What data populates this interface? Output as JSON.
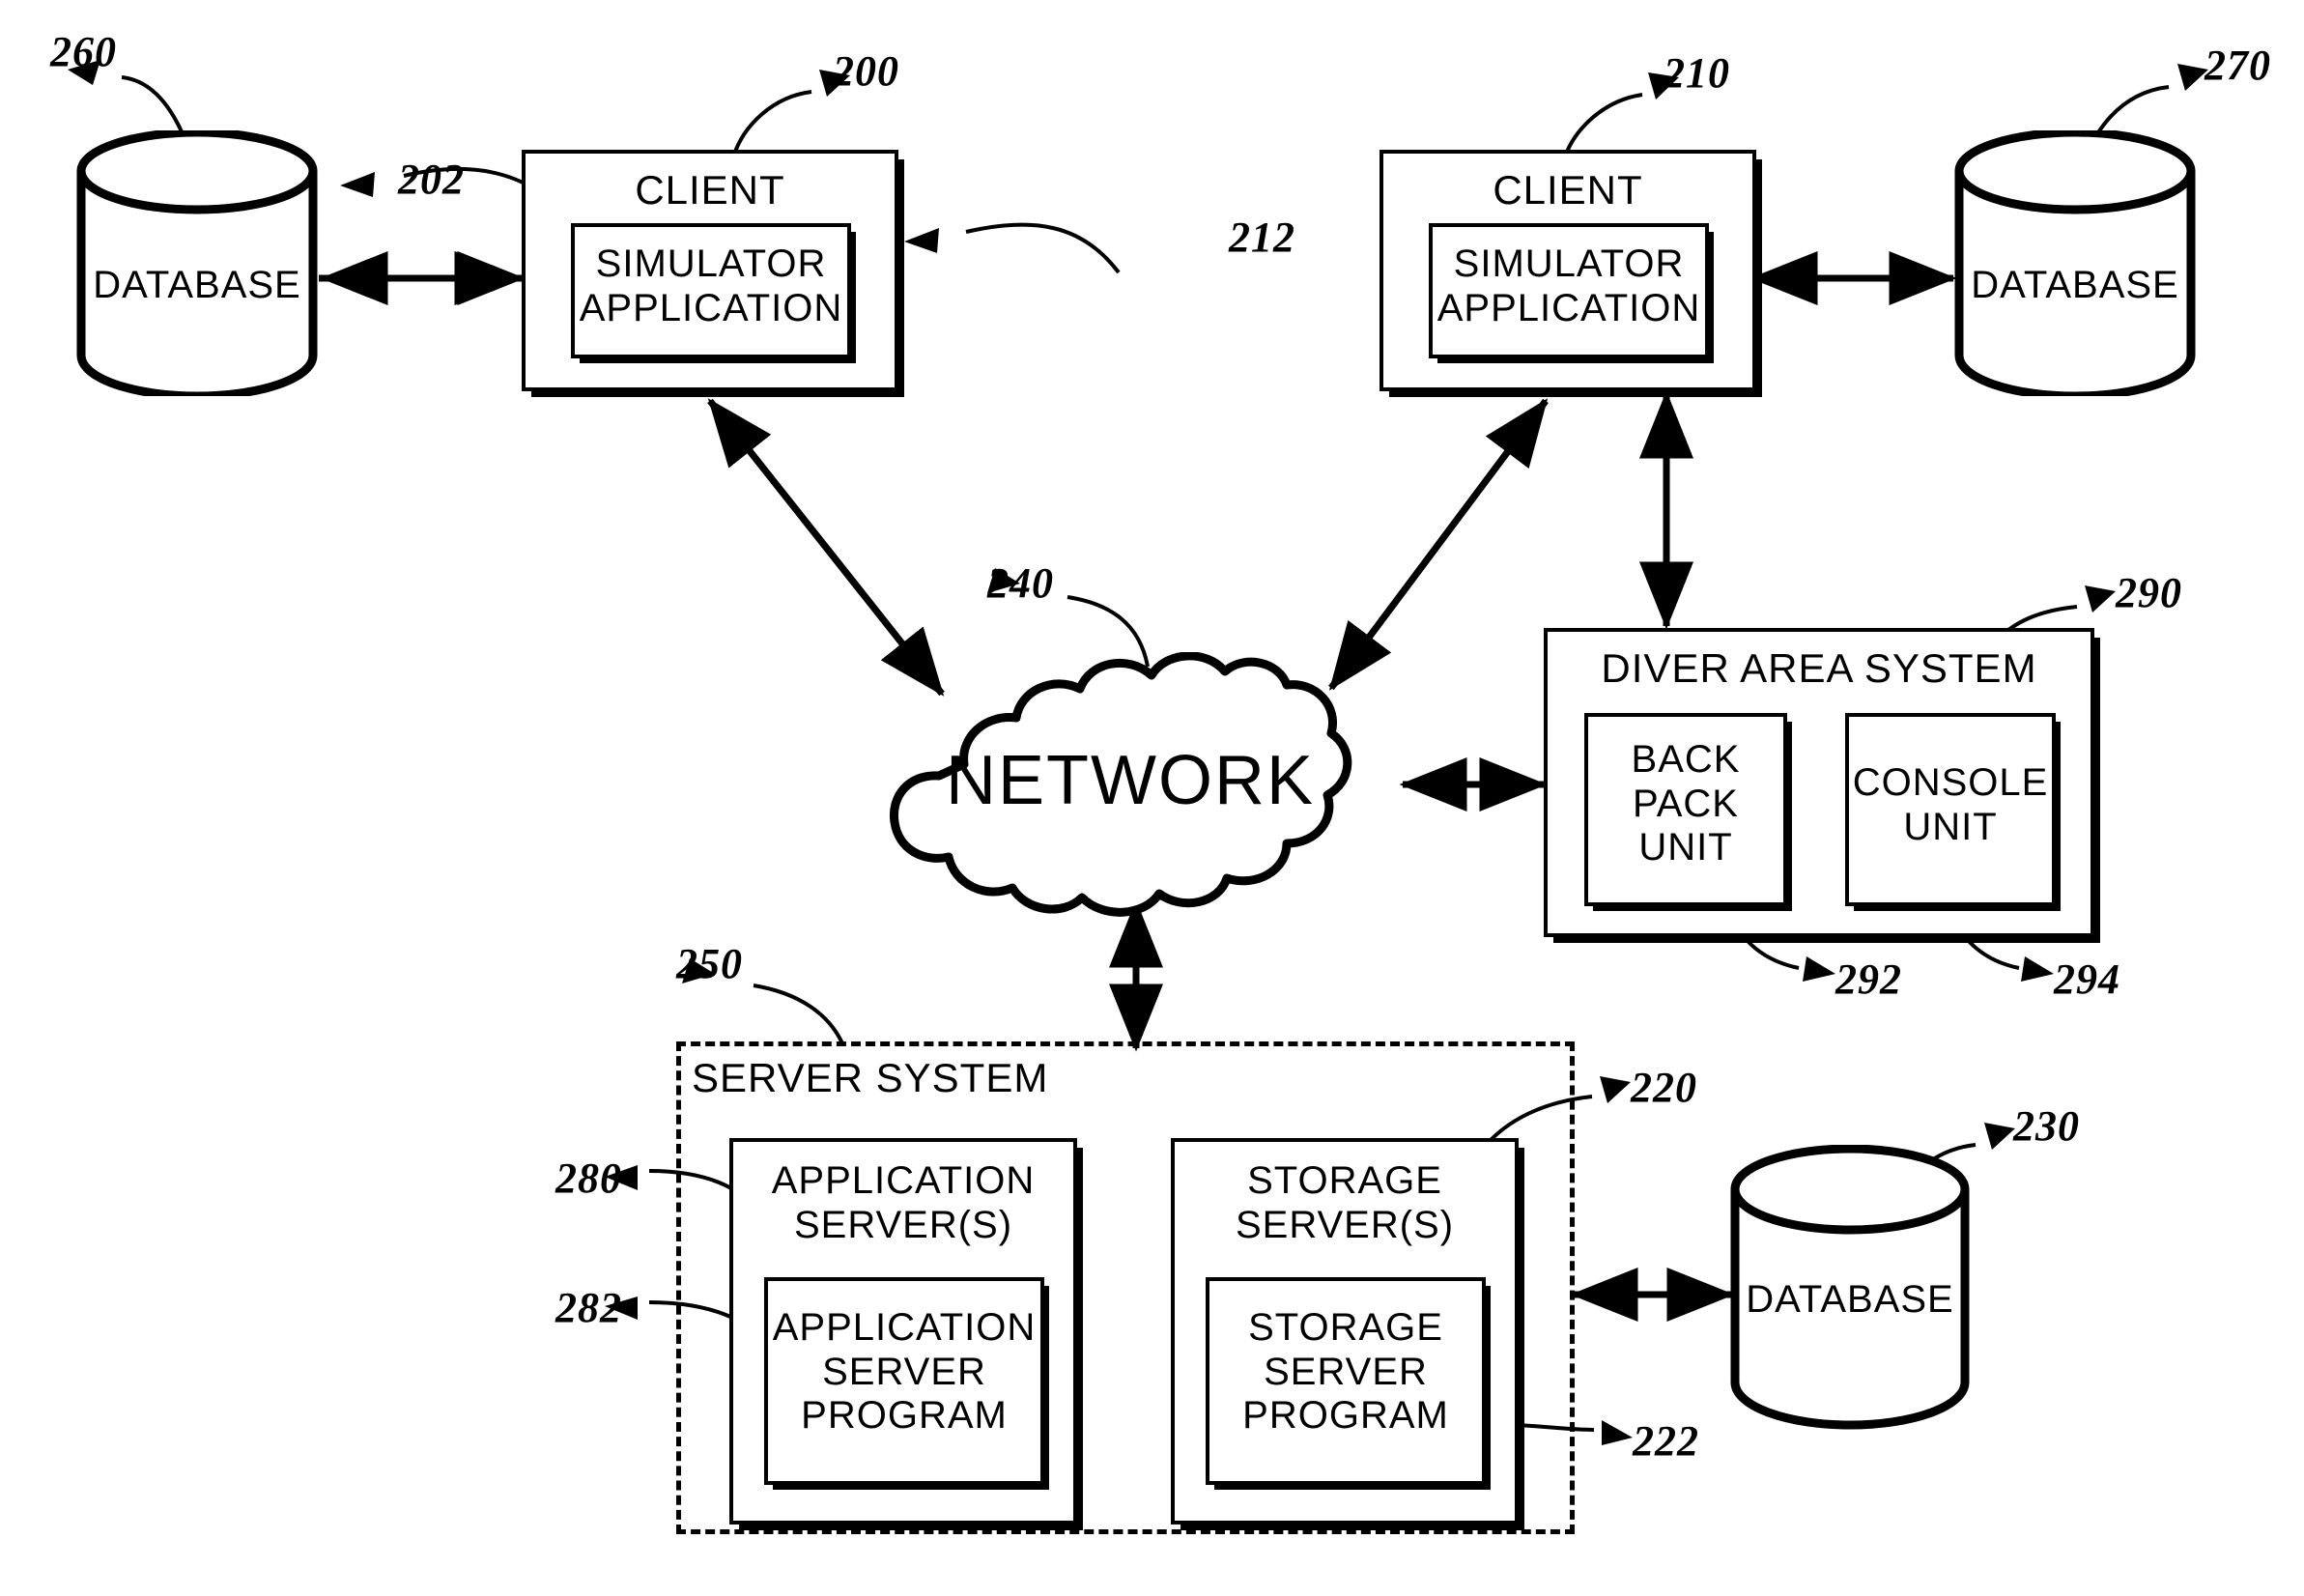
{
  "figure": {
    "type": "patent-block-diagram",
    "background": "#ffffff",
    "ink": "#000000"
  },
  "nodes": {
    "db_260": {
      "label": "DATABASE",
      "ref": "260"
    },
    "client_200": {
      "label": "CLIENT",
      "ref": "200"
    },
    "simulator_202": {
      "label": "SIMULATOR\nAPPLICATION",
      "ref": "202"
    },
    "client_210": {
      "label": "CLIENT",
      "ref": "210"
    },
    "simulator_212": {
      "label": "SIMULATOR\nAPPLICATION",
      "ref": "212"
    },
    "db_270": {
      "label": "DATABASE",
      "ref": "270"
    },
    "network_240": {
      "label": "NETWORK",
      "ref": "240"
    },
    "diver_290": {
      "label": "DIVER AREA SYSTEM",
      "ref": "290"
    },
    "backpack_292": {
      "label": "BACK\nPACK\nUNIT",
      "ref": "292"
    },
    "console_294": {
      "label": "CONSOLE\nUNIT",
      "ref": "294"
    },
    "server_system_250": {
      "label": "SERVER SYSTEM",
      "ref": "250"
    },
    "app_server_280": {
      "label": "APPLICATION\nSERVER(S)",
      "ref": "280"
    },
    "app_server_program_282": {
      "label": "APPLICATION\nSERVER\nPROGRAM",
      "ref": "282"
    },
    "storage_server_220": {
      "label": "STORAGE\nSERVER(S)",
      "ref": "220"
    },
    "storage_server_program_222": {
      "label": "STORAGE\nSERVER\nPROGRAM",
      "ref": "222"
    },
    "db_230": {
      "label": "DATABASE",
      "ref": "230"
    }
  },
  "connections": [
    {
      "name": "database-260-to-client-200",
      "from": "db_260",
      "to": "client_200",
      "arrow": "both"
    },
    {
      "name": "client-200-to-network",
      "from": "client_200",
      "to": "network_240",
      "arrow": "both"
    },
    {
      "name": "client-210-to-network",
      "from": "client_210",
      "to": "network_240",
      "arrow": "both"
    },
    {
      "name": "client-210-to-database-270",
      "from": "client_210",
      "to": "db_270",
      "arrow": "both"
    },
    {
      "name": "client-210-to-diver-area-system",
      "from": "client_210",
      "to": "diver_290",
      "arrow": "both"
    },
    {
      "name": "network-to-diver-area-system",
      "from": "network_240",
      "to": "diver_290",
      "arrow": "both"
    },
    {
      "name": "network-to-server-system",
      "from": "network_240",
      "to": "server_system_250",
      "arrow": "both"
    },
    {
      "name": "server-system-to-database-230",
      "from": "server_system_250",
      "to": "db_230",
      "arrow": "both"
    }
  ]
}
